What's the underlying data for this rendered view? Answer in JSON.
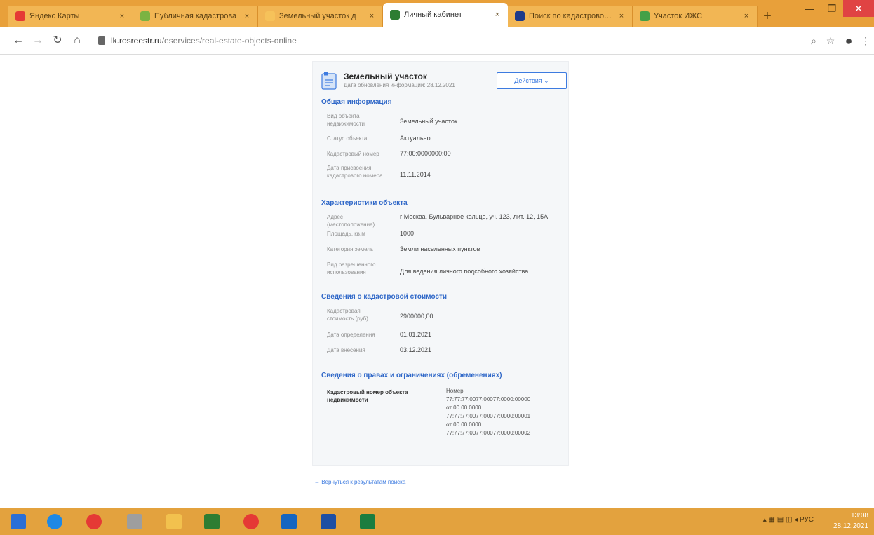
{
  "browser": {
    "tabs": [
      {
        "title": "Яндекс Карты",
        "color": "#e53935",
        "active": false
      },
      {
        "title": "Публичная кадастрова",
        "color": "#7cb342",
        "active": false
      },
      {
        "title": "Земельный участок д",
        "color": "#f6c25a",
        "active": false
      },
      {
        "title": "Личный кабинет",
        "color": "#2e7d32",
        "active": true
      },
      {
        "title": "Поиск по кадастровому",
        "color": "#1e3a8a",
        "active": false
      },
      {
        "title": "Участок ИЖС",
        "color": "#43a047",
        "active": false
      }
    ],
    "close_glyph": "×",
    "newtab_glyph": "+",
    "url_host": "lk.rosreestr.ru",
    "url_path": "/eservices/real-estate-objects-online",
    "account_glyph": "●"
  },
  "card": {
    "title": "Земельный участок",
    "subtitle": "Дата обновления информации: 28.12.2021",
    "actions_label": "Действия ⌄",
    "sections": [
      {
        "title": "Общая информация",
        "rows": [
          {
            "label": "Вид объекта недвижимости",
            "value": "Земельный участок"
          },
          {
            "label": "Статус объекта",
            "value": "Актуально"
          },
          {
            "label": "Кадастровый номер",
            "value": "77:00:0000000:00"
          },
          {
            "label": "Дата присвоения кадастрового номера",
            "value": "11.11.2014"
          }
        ]
      },
      {
        "title": "Характеристики объекта",
        "rows": [
          {
            "label": "Адрес (местоположение)",
            "value": "г Москва, Бульварное кольцо, уч. 123, лит. 12, 15А"
          },
          {
            "label": "Площадь, кв.м",
            "value": "1000"
          },
          {
            "label": "Категория земель",
            "value": "Земли населенных пунктов"
          },
          {
            "label": "Вид разрешенного использования",
            "value": "Для ведения личного подсобного хозяйства"
          }
        ]
      },
      {
        "title": "Сведения о кадастровой стоимости",
        "rows": [
          {
            "label": "Кадастровая стоимость (руб)",
            "value": "2900000,00"
          },
          {
            "label": "Дата определения",
            "value": "01.01.2021"
          },
          {
            "label": "Дата внесения",
            "value": "03.12.2021"
          }
        ]
      },
      {
        "title": "Сведения о правах и ограничениях (обременениях)",
        "rights": {
          "label": "Кадастровый номер объекта недвижимости",
          "lines": [
            "Номер",
            "77:77:77:0077:00077:0000:00000",
            "от 00.00.0000",
            "77:77:77:0077:00077:0000:00001",
            "от 00.00.0000",
            "77:77:77:0077:00077:0000:00002"
          ]
        }
      }
    ]
  },
  "back_link": "← Вернуться к результатам поиска",
  "taskbar": {
    "apps": [
      {
        "name": "windows",
        "color": "#2b6fd6"
      },
      {
        "name": "ie",
        "color": "#1e88e5"
      },
      {
        "name": "chrome",
        "color": "#e53935"
      },
      {
        "name": "media",
        "color": "#9e9e9e"
      },
      {
        "name": "explorer",
        "color": "#f2c14e"
      },
      {
        "name": "photoshop",
        "color": "#2e7d32"
      },
      {
        "name": "opera",
        "color": "#e53935"
      },
      {
        "name": "outlook",
        "color": "#1565c0"
      },
      {
        "name": "word",
        "color": "#1e4fa3"
      },
      {
        "name": "excel",
        "color": "#1b7d3f"
      }
    ],
    "tray_text": "РУС",
    "clock_time": "13:08",
    "clock_date": "28.12.2021"
  },
  "colors": {
    "accent": "#3d7be0",
    "tabbar": "#e8a03a"
  }
}
